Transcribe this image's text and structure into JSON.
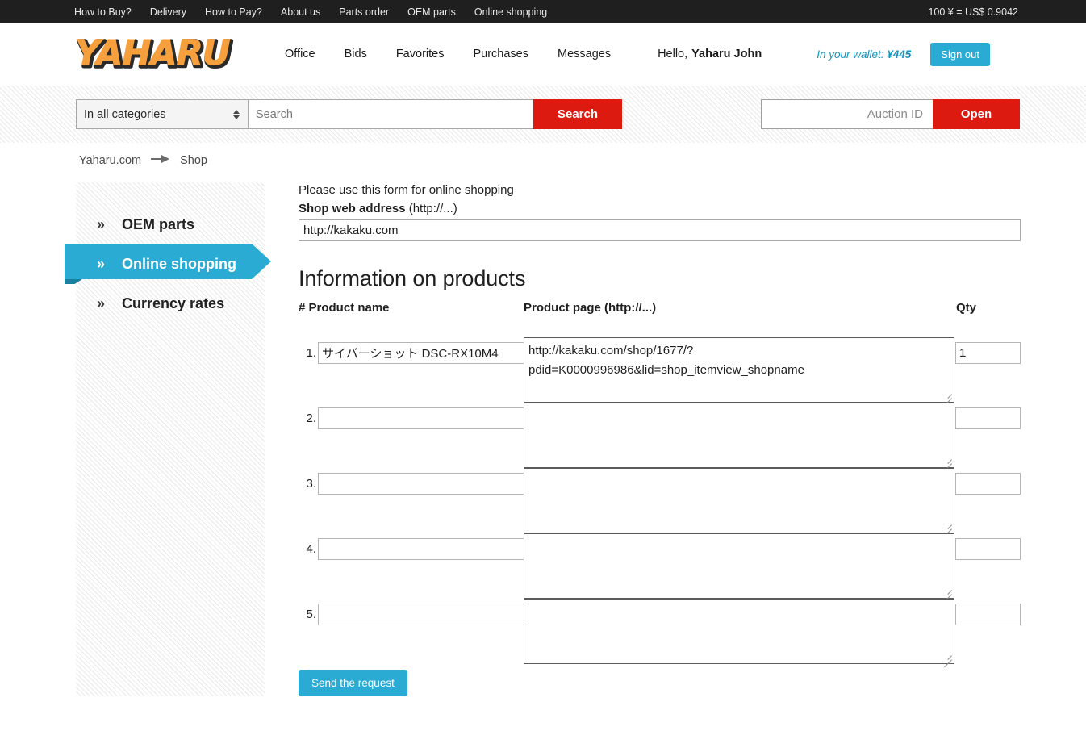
{
  "topbar": {
    "links": [
      {
        "label": "How to Buy?"
      },
      {
        "label": "Delivery"
      },
      {
        "label": "How to Pay?"
      },
      {
        "label": "About us"
      },
      {
        "label": "Parts order"
      },
      {
        "label": "OEM parts"
      },
      {
        "label": "Online shopping"
      }
    ],
    "exchange_rate": "100 ¥ = US$ 0.9042"
  },
  "header": {
    "logo_text": "YAHARU",
    "nav": [
      {
        "label": "Office"
      },
      {
        "label": "Bids"
      },
      {
        "label": "Favorites"
      },
      {
        "label": "Purchases"
      },
      {
        "label": "Messages"
      }
    ],
    "greeting_prefix": "Hello,",
    "user_name": "Yaharu John",
    "wallet_label": "In your wallet:",
    "wallet_amount": "¥445",
    "sign_out_label": "Sign out"
  },
  "search": {
    "category_value": "In all categories",
    "category_options": [
      "In all categories"
    ],
    "search_placeholder": "Search",
    "search_value": "",
    "search_button_label": "Search",
    "auction_placeholder": "Auction ID",
    "auction_value": "",
    "open_button_label": "Open"
  },
  "breadcrumb": {
    "root": "Yaharu.com",
    "arrow_icon": "arrow-right-icon",
    "current": "Shop"
  },
  "sidebar": {
    "chevron_icon": "»",
    "items": [
      {
        "label": "OEM parts",
        "active": false
      },
      {
        "label": "Online shopping",
        "active": true
      },
      {
        "label": "Currency rates",
        "active": false
      }
    ],
    "accent_color": "#29abd4",
    "accent_fold_color": "#1a7f9e"
  },
  "main": {
    "intro_text": "Please use this form for online shopping",
    "shop_label_bold": "Shop web address",
    "shop_label_rest": "(http://...)",
    "shop_url_value": "http://kakaku.com",
    "section_title": "Information on products",
    "columns": {
      "number_and_name": "# Product name",
      "product_page": "Product page (http://...)",
      "qty": "Qty"
    },
    "rows": [
      {
        "number": "1.",
        "product_name": "サイバーショット DSC-RX10M4",
        "product_page": "http://kakaku.com/shop/1677/?pdid=K0000996986&lid=shop_itemview_shopname",
        "qty": "1"
      },
      {
        "number": "2.",
        "product_name": "",
        "product_page": "",
        "qty": ""
      },
      {
        "number": "3.",
        "product_name": "",
        "product_page": "",
        "qty": ""
      },
      {
        "number": "4.",
        "product_name": "",
        "product_page": "",
        "qty": ""
      },
      {
        "number": "5.",
        "product_name": "",
        "product_page": "",
        "qty": ""
      }
    ],
    "submit_label": "Send the request"
  },
  "colors": {
    "topbar_bg": "#201f1f",
    "accent_red": "#dd1a10",
    "accent_teal": "#29abd4",
    "logo_orange": "#f5a03c"
  }
}
